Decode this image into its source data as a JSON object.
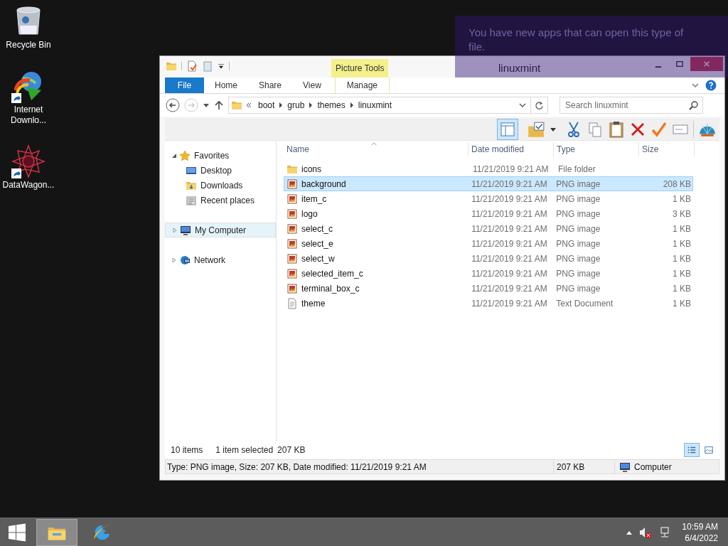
{
  "desktop_icons": [
    {
      "label": "Recycle Bin",
      "kind": "trash",
      "shortcut": false
    },
    {
      "label": "Internet Downlo...",
      "kind": "downloader",
      "shortcut": true
    },
    {
      "label": "DataWagon...",
      "kind": "star",
      "shortcut": true
    }
  ],
  "notification": {
    "text": "You have new apps that can open this type of file."
  },
  "window": {
    "title": "linuxmint",
    "contextual_tab": "Picture Tools",
    "ribbon_tabs": [
      {
        "label": "File",
        "kind": "file"
      },
      {
        "label": "Home",
        "kind": "tab"
      },
      {
        "label": "Share",
        "kind": "tab"
      },
      {
        "label": "View",
        "kind": "tab"
      },
      {
        "label": "Manage",
        "kind": "contextual"
      }
    ],
    "address": {
      "breadcrumb": [
        "boot",
        "grub",
        "themes",
        "linuxmint"
      ]
    },
    "search": {
      "placeholder": "Search linuxmint"
    },
    "navigation": [
      {
        "label": "Favorites",
        "kind": "favorites",
        "selected": false,
        "children": [
          {
            "label": "Desktop",
            "kind": "desktop",
            "selected": false
          },
          {
            "label": "Downloads",
            "kind": "downloads",
            "selected": false
          },
          {
            "label": "Recent places",
            "kind": "recent",
            "selected": false
          }
        ]
      },
      {
        "label": "My Computer",
        "kind": "computer",
        "selected": true
      },
      {
        "label": "Network",
        "kind": "network",
        "selected": false
      }
    ],
    "columns": [
      {
        "label": "Name",
        "sorted": true
      },
      {
        "label": "Date modified",
        "sorted": false
      },
      {
        "label": "Type",
        "sorted": false
      },
      {
        "label": "Size",
        "sorted": false
      }
    ],
    "rows": [
      {
        "name": "icons",
        "date": "11/21/2019 9:21 AM",
        "type": "File folder",
        "kind": "folder",
        "selected": false
      },
      {
        "name": "background",
        "date": "11/21/2019 9:21 AM",
        "type": "PNG image",
        "size": "208 KB",
        "kind": "image",
        "selected": true
      },
      {
        "name": "item_c",
        "date": "11/21/2019 9:21 AM",
        "type": "PNG image",
        "size": "1 KB",
        "kind": "image",
        "selected": false
      },
      {
        "name": "logo",
        "date": "11/21/2019 9:21 AM",
        "type": "PNG image",
        "size": "3 KB",
        "kind": "image",
        "selected": false
      },
      {
        "name": "select_c",
        "date": "11/21/2019 9:21 AM",
        "type": "PNG image",
        "size": "1 KB",
        "kind": "image",
        "selected": false
      },
      {
        "name": "select_e",
        "date": "11/21/2019 9:21 AM",
        "type": "PNG image",
        "size": "1 KB",
        "kind": "image",
        "selected": false
      },
      {
        "name": "select_w",
        "date": "11/21/2019 9:21 AM",
        "type": "PNG image",
        "size": "1 KB",
        "kind": "image",
        "selected": false
      },
      {
        "name": "selected_item_c",
        "date": "11/21/2019 9:21 AM",
        "type": "PNG image",
        "size": "1 KB",
        "kind": "image",
        "selected": false
      },
      {
        "name": "terminal_box_c",
        "date": "11/21/2019 9:21 AM",
        "type": "PNG image",
        "size": "1 KB",
        "kind": "image",
        "selected": false
      },
      {
        "name": "theme",
        "date": "11/21/2019 9:21 AM",
        "type": "Text Document",
        "size": "1 KB",
        "kind": "text",
        "selected": false
      }
    ],
    "status": {
      "items": "10 items",
      "selection": "1 item selected",
      "selection_size": "207 KB",
      "views": [
        {
          "kind": "details",
          "selected": true
        },
        {
          "kind": "icons",
          "selected": false
        }
      ]
    },
    "details_bar": {
      "text": "Type: PNG image, Size: 207 KB, Date modified: 11/21/2019 9:21 AM",
      "size": "207 KB",
      "location": "Computer"
    }
  },
  "taskbar": {
    "apps": [
      {
        "kind": "explorer",
        "selected": true
      },
      {
        "kind": "browser",
        "selected": false
      }
    ],
    "time": "10:59 AM",
    "date": "6/4/2022"
  }
}
